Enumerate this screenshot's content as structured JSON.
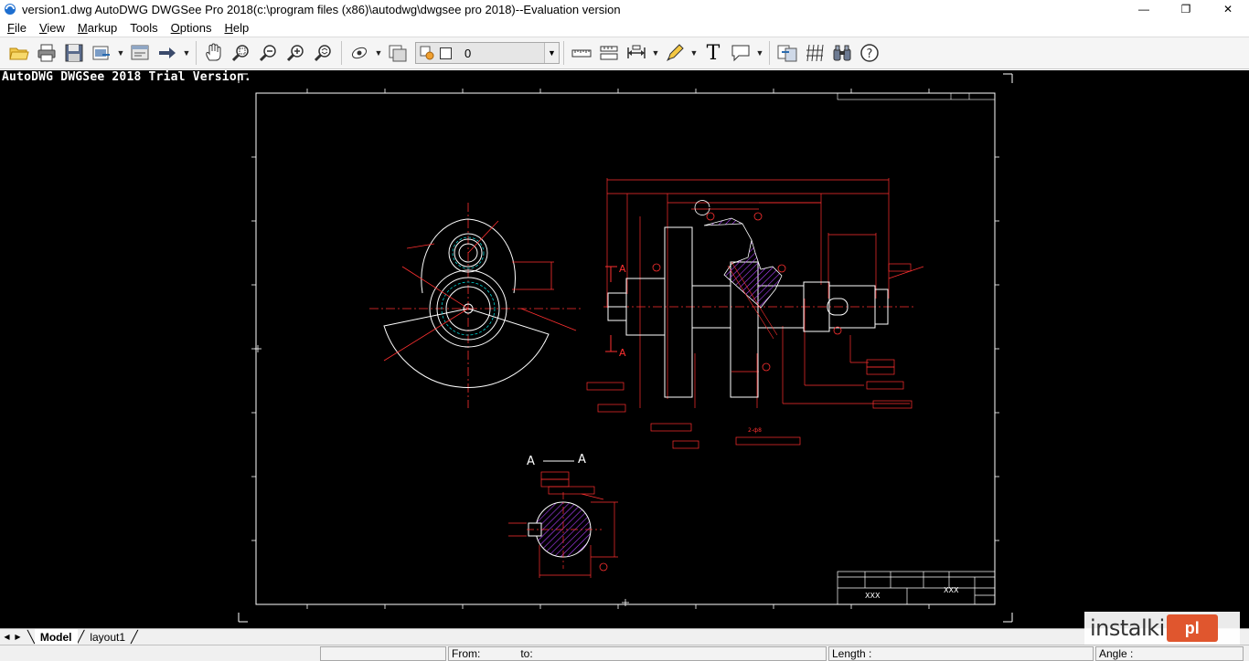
{
  "window": {
    "title": "version1.dwg AutoDWG DWGSee Pro 2018(c:\\program files (x86)\\autodwg\\dwgsee pro 2018)--Evaluation version",
    "minimize_glyph": "—",
    "restore_glyph": "❐",
    "close_glyph": "✕"
  },
  "menu": [
    {
      "underline": "F",
      "rest": "ile"
    },
    {
      "underline": "V",
      "rest": "iew"
    },
    {
      "underline": "M",
      "rest": "arkup"
    },
    {
      "underline": "",
      "rest": "Tools"
    },
    {
      "underline": "O",
      "rest": "ptions"
    },
    {
      "underline": "H",
      "rest": "elp"
    }
  ],
  "toolbar": {
    "layer_value": "0",
    "text_tool_glyph": "T",
    "help_glyph": "?"
  },
  "canvas": {
    "trial_text": "AutoDWG DWGSee 2018 Trial Version.",
    "background": "#000000",
    "drawing_color": "#ff0000",
    "frame_color": "#ffffff"
  },
  "drawing": {
    "section_label_left": "A",
    "section_label_right": "A",
    "title_block_xxx_1": "XXX",
    "title_block_xxx_2": "XXX",
    "view_label": "A",
    "note_2": "2-ф8"
  },
  "tabs": [
    {
      "label": "Model",
      "active": true
    },
    {
      "label": "layout1",
      "active": false
    }
  ],
  "status": {
    "from_label": "From:",
    "to_label": "to:",
    "length_label": "Length :",
    "angle_label": "Angle :"
  },
  "watermark": {
    "text": "instalki",
    "logo_text": "pl"
  }
}
